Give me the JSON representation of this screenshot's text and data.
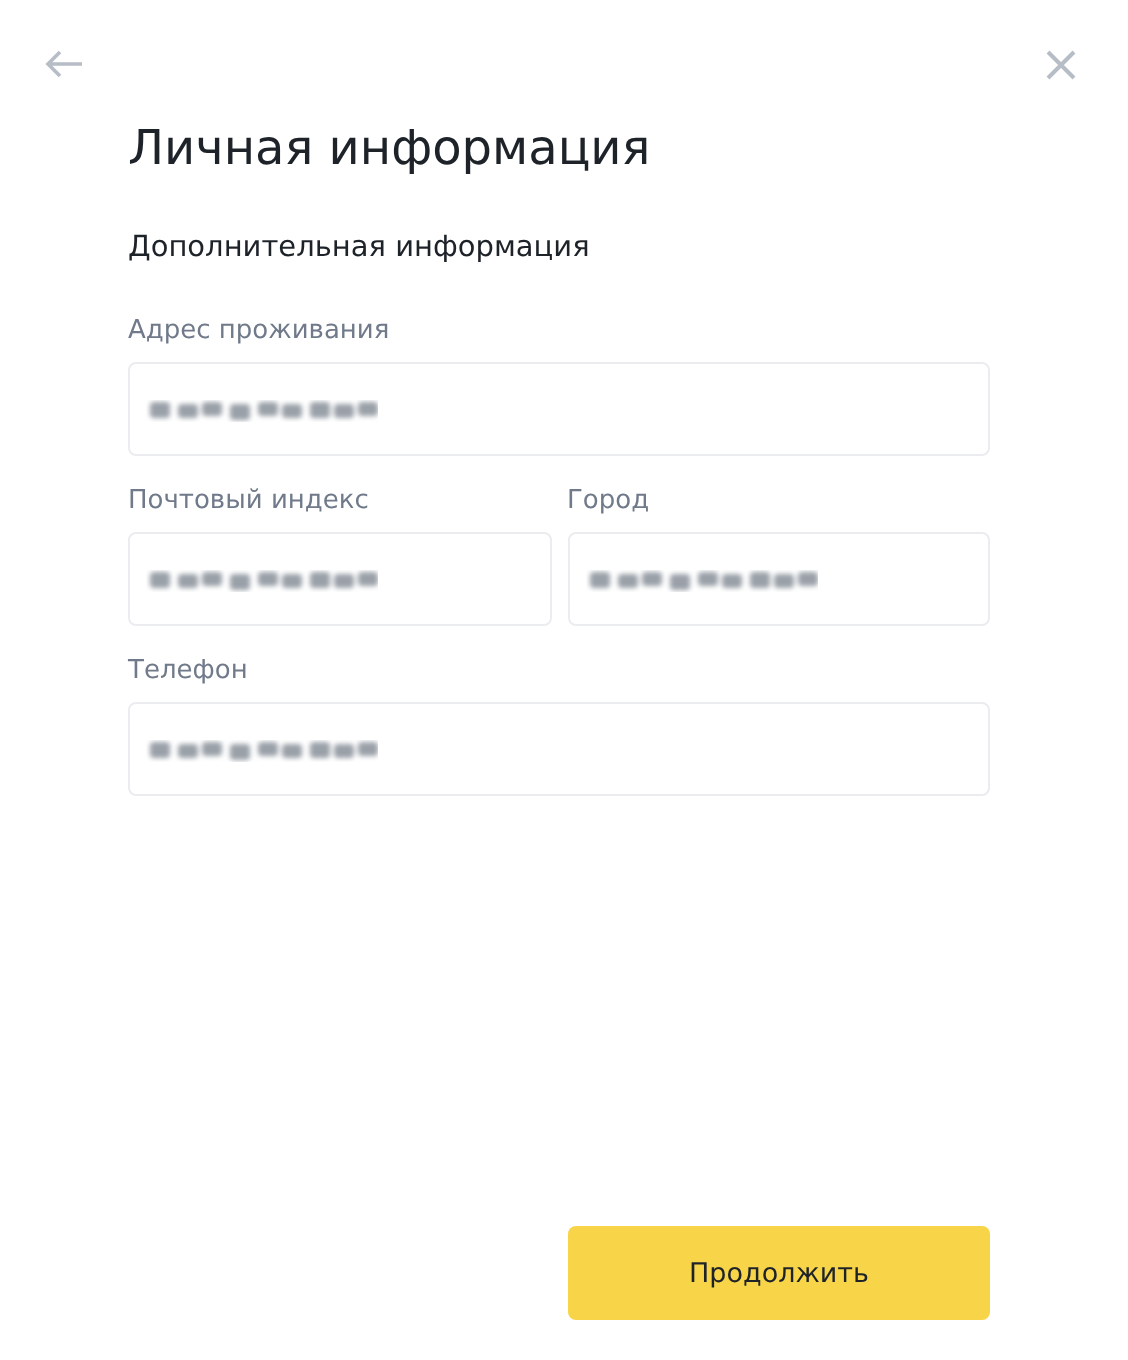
{
  "header": {
    "back": true,
    "close": true
  },
  "title": "Личная информация",
  "section_title": "Дополнительная информация",
  "field_rows": [
    {
      "fields": [
        {
          "label": "Адрес проживания",
          "blurred": true
        }
      ]
    },
    {
      "fields": [
        {
          "label": "Почтовый индекс",
          "blurred": true
        },
        {
          "label": "Город",
          "blurred": true
        }
      ]
    },
    {
      "fields": [
        {
          "label": "Телефон",
          "blurred": true
        }
      ]
    }
  ],
  "submit_button": "Продолжить"
}
